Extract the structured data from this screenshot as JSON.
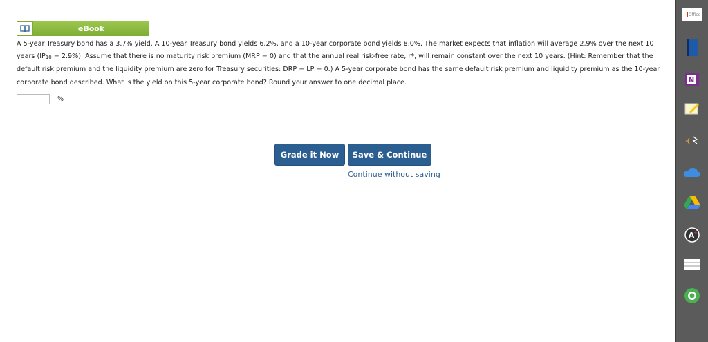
{
  "ebook": {
    "label": "eBook"
  },
  "question": {
    "part1": "A 5-year Treasury bond has a 3.7% yield. A 10-year Treasury bond yields 6.2%, and a 10-year corporate bond yields 8.0%. The market expects that inflation will average 2.9% over the next 10 years (IP",
    "sub": "10",
    "part2": " = 2.9%). Assume that there is no maturity risk premium (MRP = 0) and that the annual real risk-free rate, r*, will remain constant over the next 10 years. (Hint: Remember that the default risk premium and the liquidity premium are zero for Treasury securities: DRP = LP = 0.) A 5-year corporate bond has the same default risk premium and liquidity premium as the 10-year corporate bond described. What is the yield on this 5-year corporate bond? Round your answer to one decimal place."
  },
  "answer": {
    "value": "",
    "unit": "%"
  },
  "buttons": {
    "grade": "Grade it Now",
    "save": "Save & Continue",
    "continue": "Continue without saving"
  },
  "sidebar": {
    "office_label": "Office"
  },
  "colors": {
    "primary": "#2c5f91",
    "ebook_green": "#8bb740",
    "sidebar": "#5b5b5b"
  }
}
